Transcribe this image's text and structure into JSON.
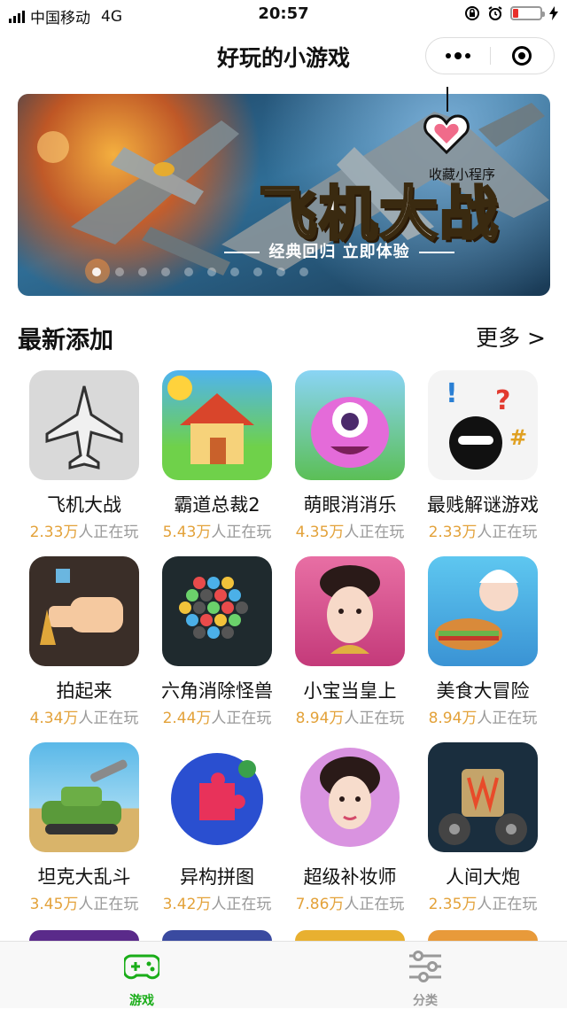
{
  "status_bar": {
    "carrier": "中国移动",
    "network": "4G",
    "time": "20:57"
  },
  "nav": {
    "title": "好玩的小游戏"
  },
  "banner": {
    "title": "飞机大战",
    "subtitle": "经典回归 立即体验",
    "favorite_label": "收藏小程序"
  },
  "section": {
    "title": "最新添加",
    "more_label": "更多 >"
  },
  "games": [
    {
      "name": "飞机大战",
      "count": "2.33万",
      "suffix": "人正在玩"
    },
    {
      "name": "霸道总裁2",
      "count": "5.43万",
      "suffix": "人正在玩"
    },
    {
      "name": "萌眼消消乐",
      "count": "4.35万",
      "suffix": "人正在玩"
    },
    {
      "name": "最贱解谜游戏",
      "count": "2.33万",
      "suffix": "人正在玩"
    },
    {
      "name": "拍起来",
      "count": "4.34万",
      "suffix": "人正在玩"
    },
    {
      "name": "六角消除怪兽",
      "count": "2.44万",
      "suffix": "人正在玩"
    },
    {
      "name": "小宝当皇上",
      "count": "8.94万",
      "suffix": "人正在玩"
    },
    {
      "name": "美食大冒险",
      "count": "8.94万",
      "suffix": "人正在玩"
    },
    {
      "name": "坦克大乱斗",
      "count": "3.45万",
      "suffix": "人正在玩"
    },
    {
      "name": "异构拼图",
      "count": "3.42万",
      "suffix": "人正在玩"
    },
    {
      "name": "超级补妆师",
      "count": "7.86万",
      "suffix": "人正在玩"
    },
    {
      "name": "人间大炮",
      "count": "2.35万",
      "suffix": "人正在玩"
    }
  ],
  "tabs": [
    {
      "label": "游戏",
      "icon": "gamepad-icon",
      "active": true
    },
    {
      "label": "分类",
      "icon": "sliders-icon",
      "active": false
    }
  ],
  "colors": {
    "accent": "#1aad19",
    "player_count": "#e3a23a",
    "muted": "#999999"
  }
}
